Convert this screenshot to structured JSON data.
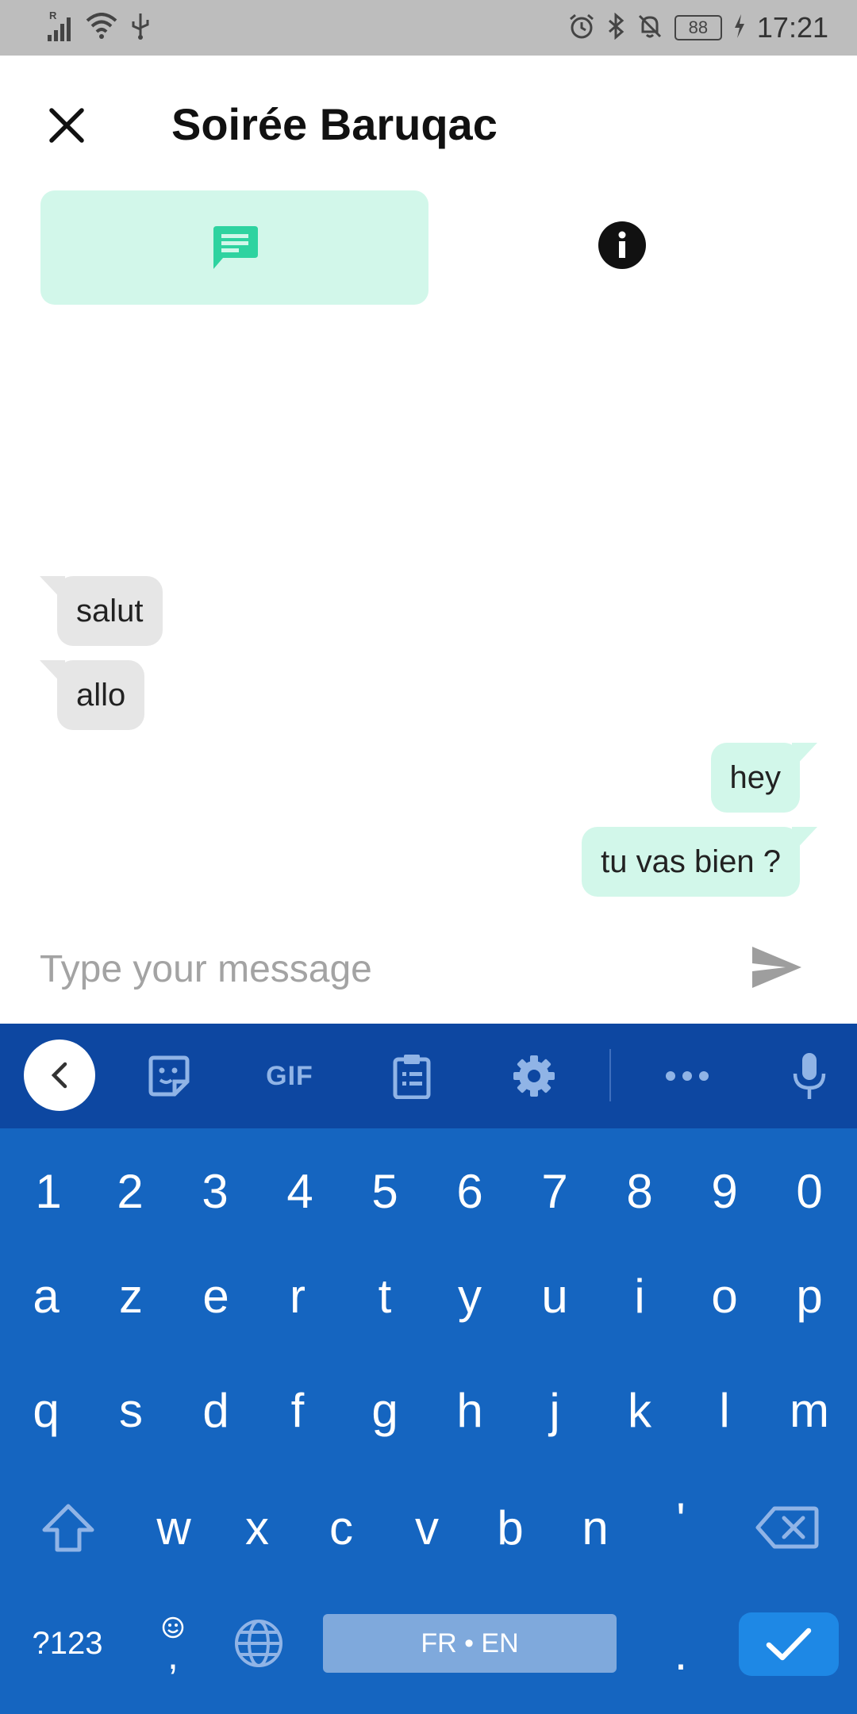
{
  "status_bar": {
    "time": "17:21",
    "battery": "88",
    "network_label": "R",
    "icons": [
      "signal-icon",
      "wifi-icon",
      "usb-icon",
      "alarm-icon",
      "bluetooth-icon",
      "notifications-off-icon",
      "battery-icon",
      "charging-icon"
    ]
  },
  "header": {
    "title": "Soirée Baruqac",
    "close_icon": "close-icon"
  },
  "tabs": [
    {
      "name": "chat",
      "icon": "chat-bubble-icon",
      "selected": true
    },
    {
      "name": "info",
      "icon": "info-icon",
      "selected": false
    }
  ],
  "messages": [
    {
      "text": "salut",
      "direction": "incoming"
    },
    {
      "text": "allo",
      "direction": "incoming"
    },
    {
      "text": "hey",
      "direction": "outgoing"
    },
    {
      "text": "tu vas bien ?",
      "direction": "outgoing"
    }
  ],
  "composer": {
    "placeholder": "Type your message",
    "value": "",
    "send_icon": "send-icon"
  },
  "keyboard": {
    "toolbar": {
      "gif_label": "GIF",
      "icons": [
        "back-arrow-icon",
        "sticker-icon",
        "clipboard-icon",
        "settings-icon",
        "more-icon",
        "microphone-icon"
      ]
    },
    "row_numbers": [
      "1",
      "2",
      "3",
      "4",
      "5",
      "6",
      "7",
      "8",
      "9",
      "0"
    ],
    "row_1": [
      "a",
      "z",
      "e",
      "r",
      "t",
      "y",
      "u",
      "i",
      "o",
      "p"
    ],
    "row_2": [
      "q",
      "s",
      "d",
      "f",
      "g",
      "h",
      "j",
      "k",
      "l",
      "m"
    ],
    "row_3": [
      "w",
      "x",
      "c",
      "v",
      "b",
      "n",
      "'"
    ],
    "symbols_label": "?123",
    "comma_label": ",",
    "period_label": ".",
    "space_label": "FR • EN"
  },
  "colors": {
    "accent": "#2ed3a0",
    "accent_light": "#d2f7ea",
    "incoming_bubble": "#e6e6e6",
    "keyboard_bg": "#1565c0",
    "keyboard_toolbar": "#0d47a1",
    "enter_key": "#1e88e5"
  }
}
